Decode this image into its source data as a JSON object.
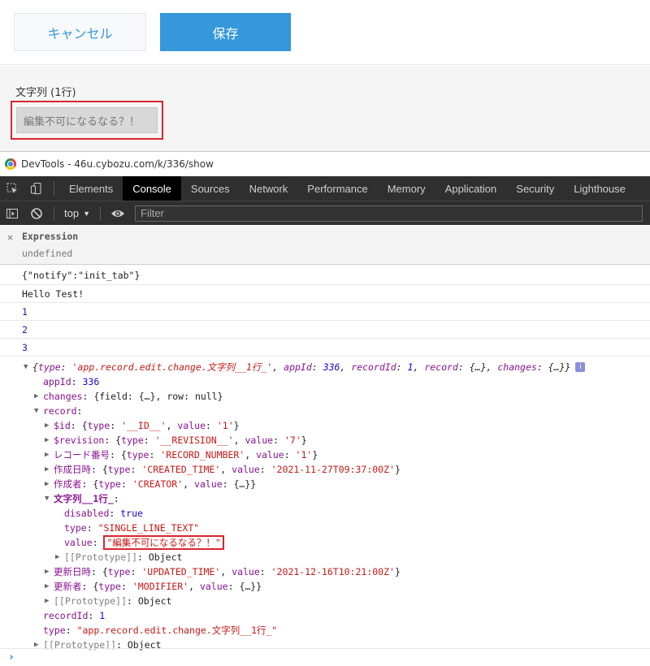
{
  "toolbar": {
    "cancel_label": "キャンセル",
    "save_label": "保存"
  },
  "field": {
    "label": "文字列 (1行)",
    "value": "編集不可になるなる？！"
  },
  "devtools": {
    "title": "DevTools - 46u.cybozu.com/k/336/show",
    "tabs": [
      "Elements",
      "Console",
      "Sources",
      "Network",
      "Performance",
      "Memory",
      "Application",
      "Security",
      "Lighthouse"
    ],
    "active_tab": "Console",
    "context": "top",
    "filter_placeholder": "Filter",
    "expression": {
      "label": "Expression",
      "value": "undefined"
    },
    "logs": [
      "{\"notify\":\"init_tab\"}",
      "Hello Test!",
      "1",
      "2",
      "3"
    ],
    "object": {
      "summary_type": "'app.record.edit.change.文字列__1行_'",
      "summary_app_id": "336",
      "summary_record_id": "1",
      "appId_key": "appId",
      "appId_val": "336",
      "changes_key": "changes",
      "changes_val": "{field: {…}, row: null}",
      "record_key": "record",
      "fields": [
        {
          "key": "$id",
          "type": "'__ID__'",
          "value": "'1'"
        },
        {
          "key": "$revision",
          "type": "'__REVISION__'",
          "value": "'7'"
        },
        {
          "key": "レコード番号",
          "type": "'RECORD_NUMBER'",
          "value": "'1'"
        },
        {
          "key": "作成日時",
          "type": "'CREATED_TIME'",
          "value": "'2021-11-27T09:37:00Z'"
        },
        {
          "key": "作成者",
          "type": "'CREATOR'",
          "value": "{…}"
        }
      ],
      "expanded_key": "文字列__1行_",
      "expanded": {
        "disabled_key": "disabled",
        "disabled_val": "true",
        "type_key": "type",
        "type_val": "\"SINGLE_LINE_TEXT\"",
        "value_key": "value",
        "value_val": "\"編集不可になるなる？！\""
      },
      "fields_after": [
        {
          "key": "更新日時",
          "type": "'UPDATED_TIME'",
          "value": "'2021-12-16T10:21:00Z'"
        },
        {
          "key": "更新者",
          "type": "'MODIFIER'",
          "value": "{…}"
        }
      ],
      "prototype_label": "[[Prototype]]",
      "prototype_val": "Object",
      "recordId_key": "recordId",
      "recordId_val": "1",
      "type_key": "type",
      "type_val": "\"app.record.edit.change.文字列__1行_\""
    }
  }
}
